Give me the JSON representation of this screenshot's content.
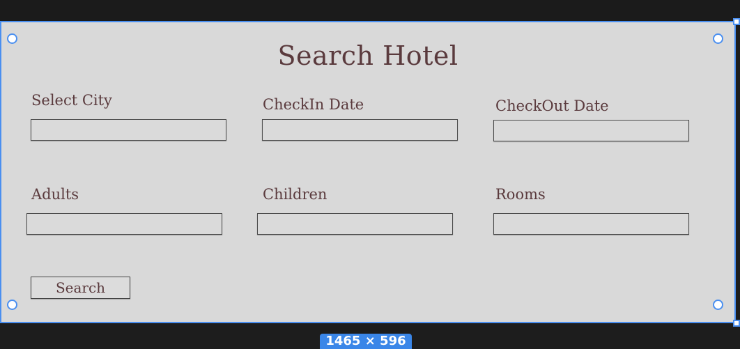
{
  "page": {
    "title": "Search Hotel"
  },
  "form": {
    "fields": [
      {
        "label": "Select City",
        "value": ""
      },
      {
        "label": "CheckIn Date",
        "value": ""
      },
      {
        "label": "CheckOut Date",
        "value": ""
      },
      {
        "label": "Adults",
        "value": ""
      },
      {
        "label": "Children",
        "value": ""
      },
      {
        "label": "Rooms",
        "value": ""
      }
    ],
    "search_label": "Search"
  },
  "canvas": {
    "size_badge": "1465 × 596"
  },
  "colors": {
    "background": "#d9d9d9",
    "text": "#5a3a3d",
    "selection": "#4a8ff0",
    "dark_surround": "#1d1d1d"
  }
}
